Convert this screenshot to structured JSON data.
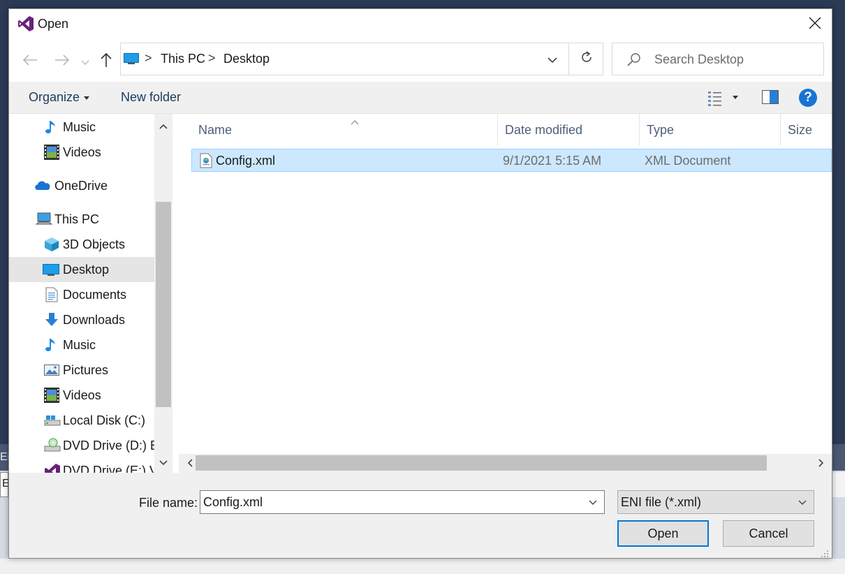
{
  "window": {
    "title": "Open",
    "title_icon": "visual-studio-icon",
    "close_icon": "close-icon"
  },
  "background_app": {
    "left_strip_text": "Er",
    "left_input_text": "E"
  },
  "navigation": {
    "back_icon": "arrow-left-icon",
    "forward_icon": "arrow-right-icon",
    "recent_icon": "chevron-down-icon",
    "up_icon": "arrow-up-icon"
  },
  "address_bar": {
    "location_icon": "desktop-icon",
    "segments": [
      "This PC",
      "Desktop"
    ],
    "separator": ">",
    "dropdown_icon": "chevron-down-icon",
    "refresh_icon": "refresh-icon"
  },
  "search": {
    "placeholder": "Search Desktop",
    "icon": "search-icon"
  },
  "toolbar": {
    "organize_label": "Organize",
    "new_folder_label": "New folder",
    "view_icon": "details-view-icon",
    "preview_icon": "preview-pane-icon",
    "help_label": "?"
  },
  "nav_pane": {
    "items": [
      {
        "label": "Music",
        "icon": "music-icon"
      },
      {
        "label": "Videos",
        "icon": "videos-icon"
      },
      {
        "label": "OneDrive",
        "icon": "onedrive-icon"
      },
      {
        "label": "This PC",
        "icon": "this-pc-icon"
      },
      {
        "label": "3D Objects",
        "icon": "3d-objects-icon"
      },
      {
        "label": "Desktop",
        "icon": "desktop-icon",
        "selected": true
      },
      {
        "label": "Documents",
        "icon": "documents-icon"
      },
      {
        "label": "Downloads",
        "icon": "downloads-icon"
      },
      {
        "label": "Music",
        "icon": "music-icon"
      },
      {
        "label": "Pictures",
        "icon": "pictures-icon"
      },
      {
        "label": "Videos",
        "icon": "videos-icon"
      },
      {
        "label": "Local Disk (C:)",
        "icon": "local-disk-icon"
      },
      {
        "label": "DVD Drive (D:) E:",
        "icon": "dvd-drive-icon"
      },
      {
        "label": "DVD Drive (E:) VS",
        "icon": "dvd-drive-vs-icon"
      }
    ]
  },
  "file_list": {
    "columns": [
      "Name",
      "Date modified",
      "Type",
      "Size"
    ],
    "sort_icon": "sort-ascending-icon",
    "rows": [
      {
        "name": "Config.xml",
        "date_modified": "9/1/2021 5:15 AM",
        "type": "XML Document",
        "size": "",
        "icon": "xml-file-icon",
        "selected": true
      }
    ]
  },
  "bottom": {
    "file_name_label": "File name:",
    "file_name_value": "Config.xml",
    "file_type_value": "ENI file (*.xml)",
    "open_label": "Open",
    "cancel_label": "Cancel"
  },
  "colors": {
    "accent": "#0078d7",
    "selection_bg": "#cce8ff",
    "selection_border": "#99d1ff",
    "nav_selected": "#e5e5e5",
    "toolbar_bg": "#f0f0f0",
    "help_blue": "#1873d3"
  }
}
